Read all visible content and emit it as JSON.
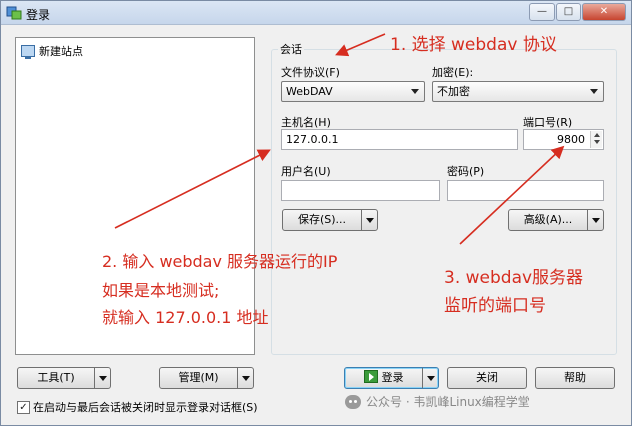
{
  "window": {
    "title": "登录",
    "min_glyph": "—",
    "max_glyph": "□",
    "close_glyph": "✕"
  },
  "tree": {
    "items": [
      {
        "label": "新建站点"
      }
    ]
  },
  "session": {
    "group_label": "会话",
    "protocol_label": "文件协议(F)",
    "protocol_value": "WebDAV",
    "encryption_label": "加密(E):",
    "encryption_value": "不加密",
    "host_label": "主机名(H)",
    "host_value": "127.0.0.1",
    "port_label": "端口号(R)",
    "port_value": "9800",
    "user_label": "用户名(U)",
    "user_value": "",
    "password_label": "密码(P)",
    "password_value": "",
    "save_label": "保存(S)...",
    "advanced_label": "高级(A)..."
  },
  "bottom": {
    "tools_label": "工具(T)",
    "manage_label": "管理(M)",
    "login_label": "登录",
    "close_label": "关闭",
    "help_label": "帮助",
    "checkbox_checked": true,
    "checkbox_mark": "✓",
    "checkbox_label": "在启动与最后会话被关闭时显示登录对话框(S)"
  },
  "annotations": {
    "a1": "1. 选择 webdav 协议",
    "a2_line1": "2. 输入 webdav 服务器运行的IP",
    "a2_line2": "如果是本地测试;",
    "a2_line3": "就输入 127.0.0.1 地址",
    "a3_line1": "3. webdav服务器",
    "a3_line2": "监听的端口号",
    "color": "#d62d20"
  },
  "watermark": {
    "text": "公众号 · 韦凯峰Linux编程学堂"
  }
}
